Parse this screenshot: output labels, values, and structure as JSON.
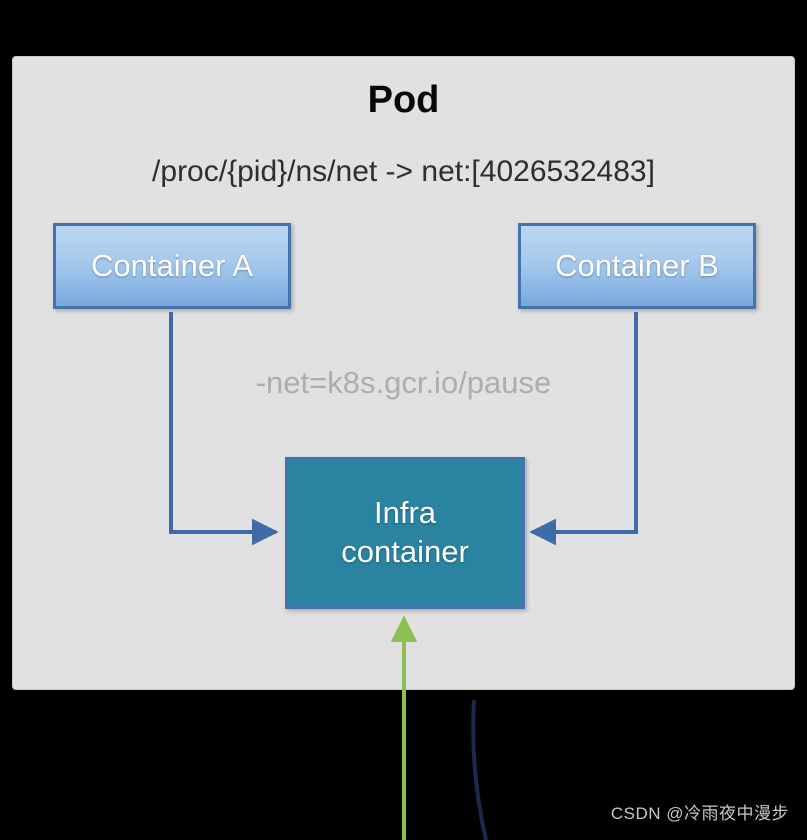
{
  "diagram": {
    "title": "Pod",
    "namespace_path": "/proc/{pid}/ns/net -> net:[4026532483]",
    "container_a": "Container A",
    "container_b": "Container B",
    "net_hint": "-net=k8s.gcr.io/pause",
    "infra_label": "Infra\ncontainer"
  },
  "watermark": "CSDN @冷雨夜中漫步"
}
